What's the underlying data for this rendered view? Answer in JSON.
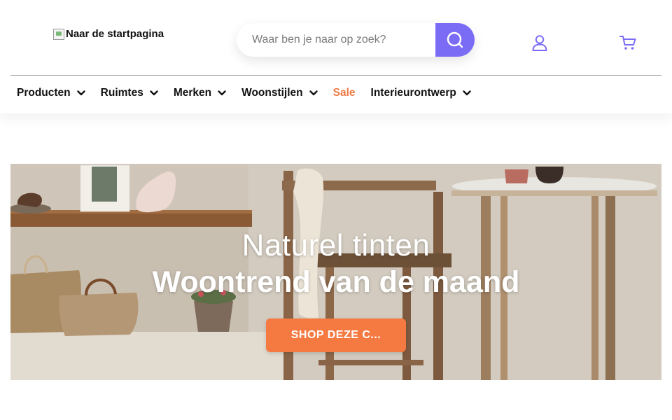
{
  "header": {
    "logo_alt": "Naar de startpagina",
    "search": {
      "placeholder": "Waar ben je naar op zoek?",
      "value": ""
    },
    "icons": {
      "search": "search-icon",
      "account": "user-icon",
      "cart": "cart-icon"
    }
  },
  "nav": {
    "items": [
      {
        "label": "Producten",
        "has_dropdown": true
      },
      {
        "label": "Ruimtes",
        "has_dropdown": true
      },
      {
        "label": "Merken",
        "has_dropdown": true
      },
      {
        "label": "Woonstijlen",
        "has_dropdown": true
      },
      {
        "label": "Sale",
        "has_dropdown": false
      },
      {
        "label": "Interieurontwerp",
        "has_dropdown": true
      }
    ]
  },
  "hero": {
    "subtitle": "Naturel tinten",
    "title": "Woontrend van de maand",
    "cta_label": "SHOP DEZE C..."
  },
  "colors": {
    "accent": "#7b6cf6",
    "sale": "#f07a45",
    "cta": "#f47a42"
  }
}
